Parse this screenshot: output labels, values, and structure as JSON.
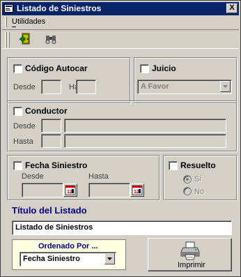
{
  "window": {
    "title": "Listado de Siniestros",
    "close_label": "X"
  },
  "menu": {
    "items": [
      "Utilidades"
    ]
  },
  "toolbar": {
    "buttons": [
      "exit-icon",
      "binoculars-icon"
    ]
  },
  "codigo_autocar": {
    "label": "Código Autocar",
    "checked": false,
    "desde_label": "Desde",
    "hasta_label": "Hasta",
    "desde_value": "",
    "hasta_value": ""
  },
  "juicio": {
    "label": "Juicio",
    "checked": false,
    "selected": "A Favor"
  },
  "conductor": {
    "label": "Conductor",
    "checked": false,
    "desde_label": "Desde",
    "hasta_label": "Hasta"
  },
  "fecha_siniestro": {
    "label": "Fecha Siniestro",
    "checked": false,
    "desde_label": "Desde",
    "hasta_label": "Hasta"
  },
  "resuelto": {
    "label": "Resuelto",
    "checked": false,
    "options": [
      "Si",
      "No"
    ],
    "selected": "Si"
  },
  "titulo": {
    "label": "Título del Listado",
    "value": "Listado de Siniestros"
  },
  "orden": {
    "label": "Ordenado Por ...",
    "selected": "Fecha Siniestro"
  },
  "imprimir": {
    "label": "Imprimir"
  },
  "colors": {
    "titlebar": "#0a246a",
    "face": "#d4d0c8",
    "label_blue": "#000080",
    "order_bg": "#ffffe1"
  }
}
